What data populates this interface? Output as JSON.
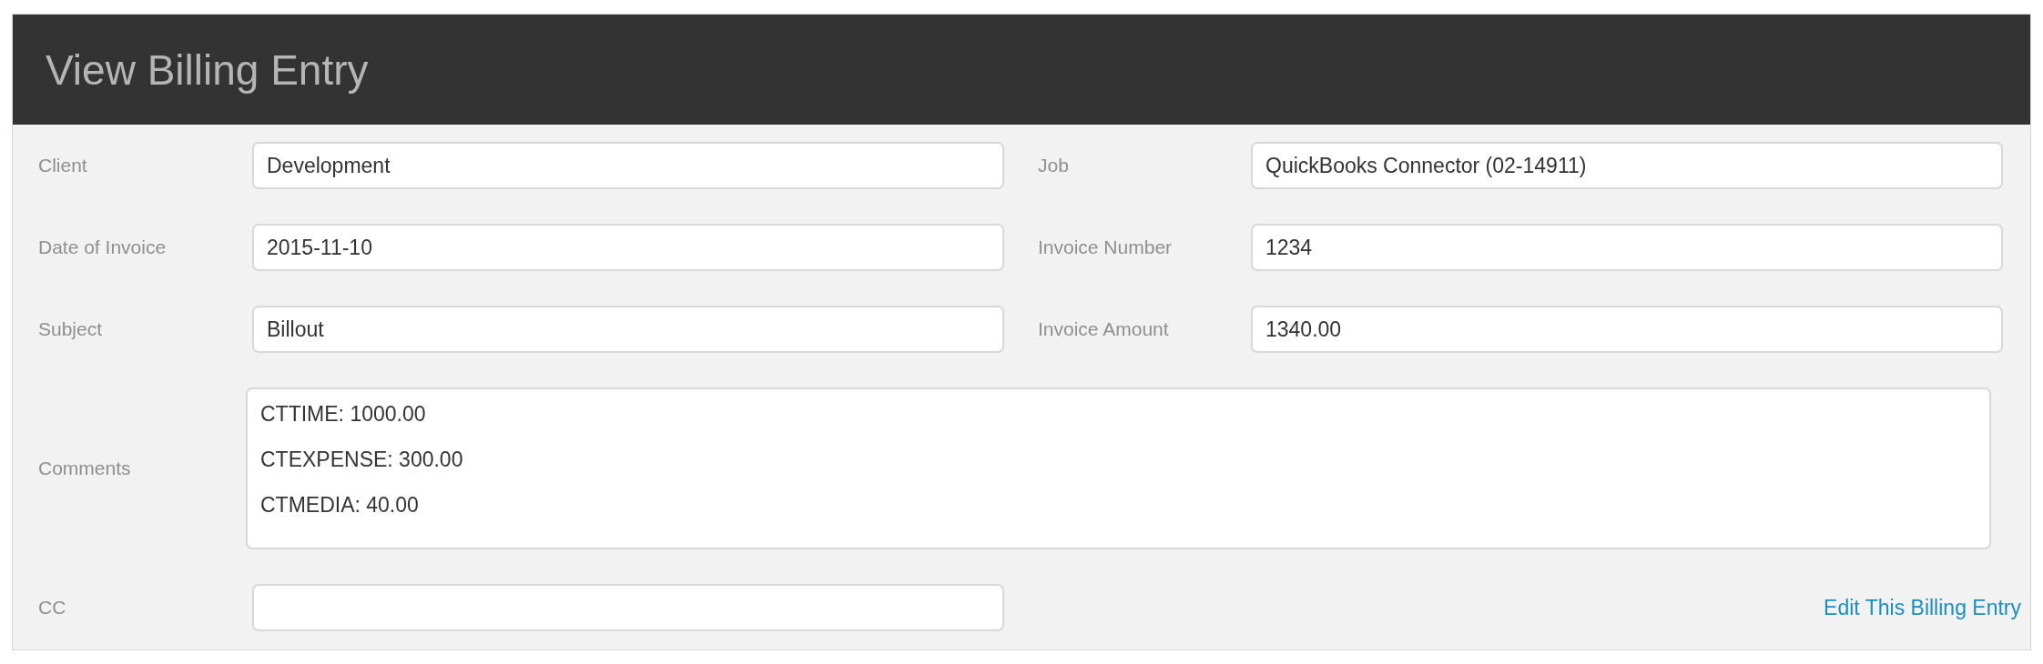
{
  "title": "View Billing Entry",
  "rows": [
    [
      {
        "label": "Client",
        "value": "Development"
      },
      {
        "label": "Job",
        "value": "QuickBooks Connector (02-14911)"
      }
    ],
    [
      {
        "label": "Date of Invoice",
        "value": "2015-11-10"
      },
      {
        "label": "Invoice Number",
        "value": "1234"
      }
    ],
    [
      {
        "label": "Subject",
        "value": "Billout"
      },
      {
        "label": "Invoice Amount",
        "value": "1340.00"
      }
    ]
  ],
  "comments": {
    "label": "Comments",
    "lines": [
      "CTTIME: 1000.00",
      "CTEXPENSE: 300.00",
      "CTMEDIA: 40.00"
    ]
  },
  "cc": {
    "label": "CC"
  },
  "edit_link": "Edit This Billing Entry"
}
